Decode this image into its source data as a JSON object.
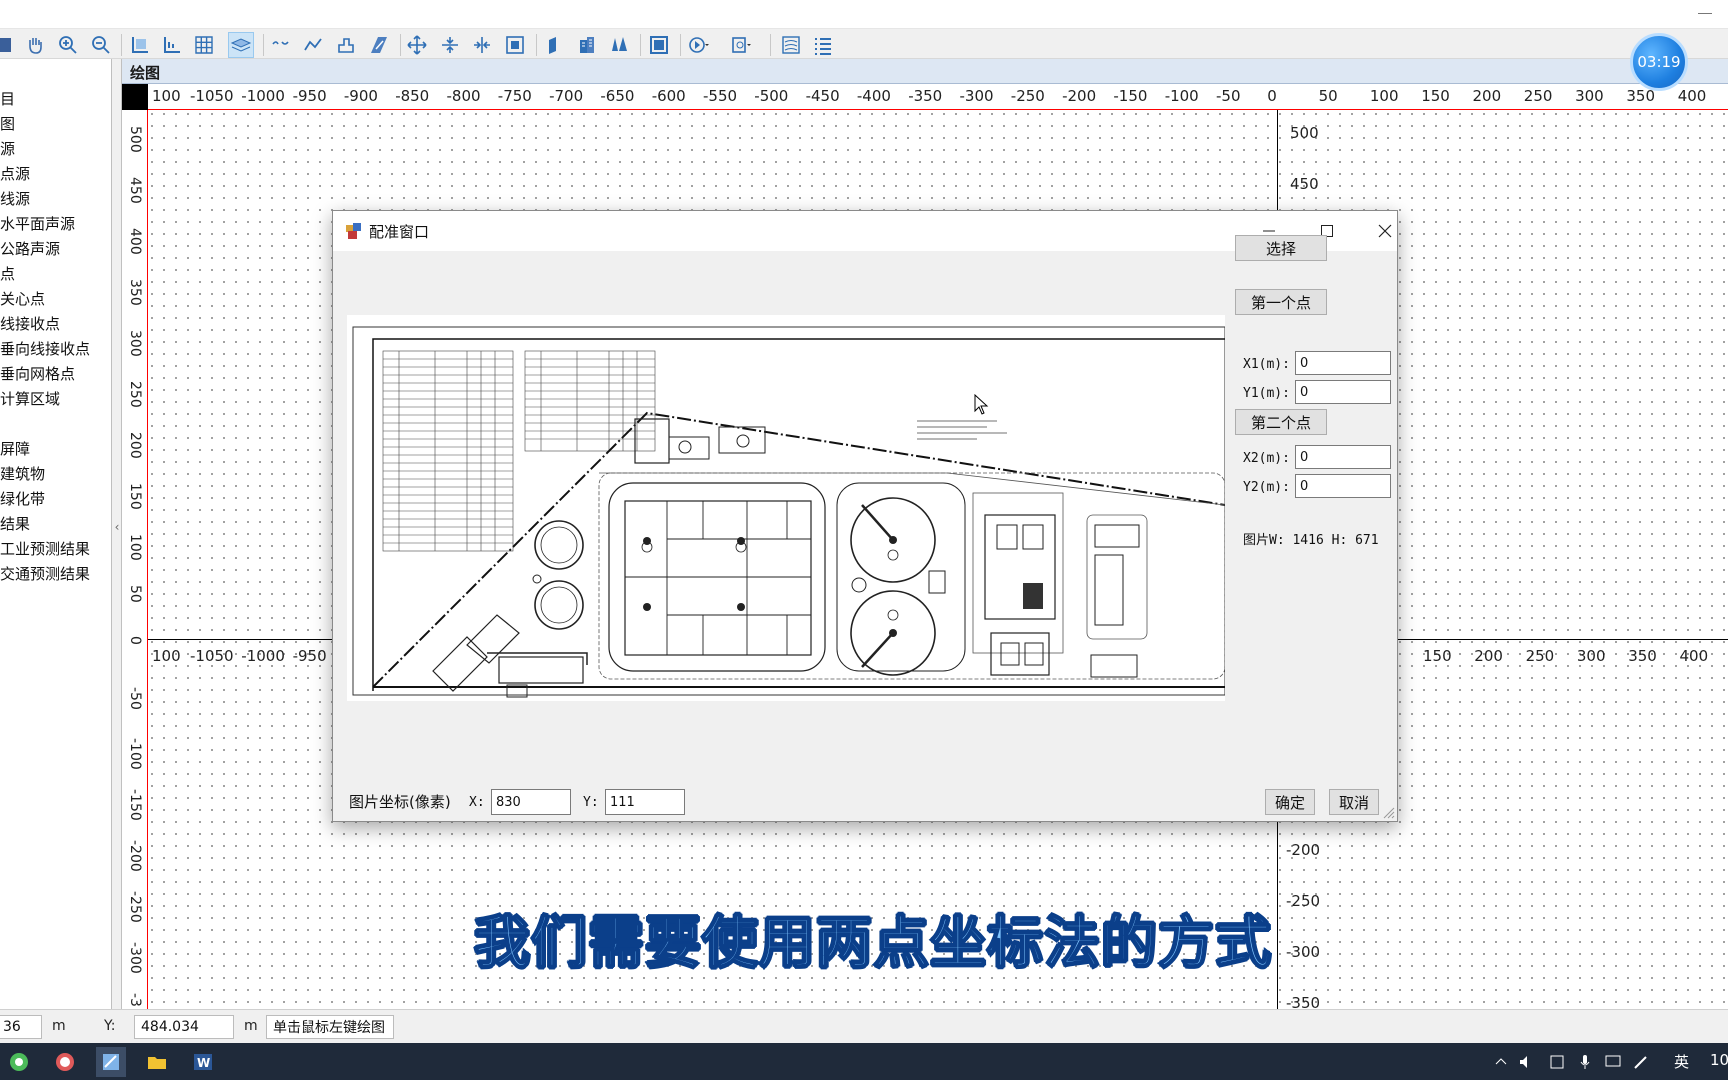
{
  "timer": "03:19",
  "left_panel": {
    "items": [
      "目",
      "图",
      "源",
      "点源",
      "线源",
      "水平面声源",
      "公路声源",
      "点",
      "关心点",
      "线接收点",
      "垂向线接收点",
      "垂向网格点",
      "计算区域",
      "屏障",
      "建筑物",
      "绿化带",
      "结果",
      "工业预测结果",
      "交通预测结果"
    ]
  },
  "drawing": {
    "header": "绘图",
    "ruler_top_labels": [
      "100",
      "-1050",
      "-1000",
      "-950",
      "-900",
      "-850",
      "-800",
      "-750",
      "-700",
      "-650",
      "-600",
      "-550",
      "-500",
      "-450",
      "-400",
      "-350",
      "-300",
      "-250",
      "-200",
      "-150",
      "-100",
      "-50",
      "0",
      "50",
      "100",
      "150",
      "200",
      "250",
      "300",
      "350",
      "400"
    ],
    "ruler_left_labels": [
      "500",
      "450",
      "400",
      "350",
      "300",
      "250",
      "200",
      "150",
      "100",
      "50",
      "0",
      "-50",
      "-100",
      "-150",
      "-200",
      "-250",
      "-300",
      "-3"
    ],
    "x_axis_left_labels": [
      "100",
      "-1050",
      "-1000",
      "-950"
    ],
    "x_axis_right_labels": [
      "150",
      "200",
      "250",
      "300",
      "350",
      "400"
    ],
    "y_axis_top_labels": [
      "500",
      "450"
    ],
    "y_axis_bottom_labels": [
      "-200",
      "-250",
      "-300",
      "-350"
    ]
  },
  "dialog": {
    "title": "配准窗口",
    "select_button": "选择",
    "first_point_button": "第一个点",
    "second_point_button": "第二个点",
    "x1_label": "X1(m):",
    "x1_value": "0",
    "y1_label": "Y1(m):",
    "y1_value": "0",
    "x2_label": "X2(m):",
    "x2_value": "0",
    "y2_label": "Y2(m):",
    "y2_value": "0",
    "image_size": "图片W: 1416 H: 671",
    "pixel_coord_label": "图片坐标(像素)",
    "px_x_label": "X:",
    "px_x_value": "830",
    "px_y_label": "Y:",
    "px_y_value": "111",
    "ok_button": "确定",
    "cancel_button": "取消"
  },
  "statusbar": {
    "x_value": "36",
    "x_unit": "m",
    "y_label": "Y:",
    "y_value": "484.034",
    "y_unit": "m",
    "hint": "单击鼠标左键绘图"
  },
  "subtitle": "我们需要使用两点坐标法的方式",
  "tray": {
    "ime": "英",
    "clock": "10"
  }
}
